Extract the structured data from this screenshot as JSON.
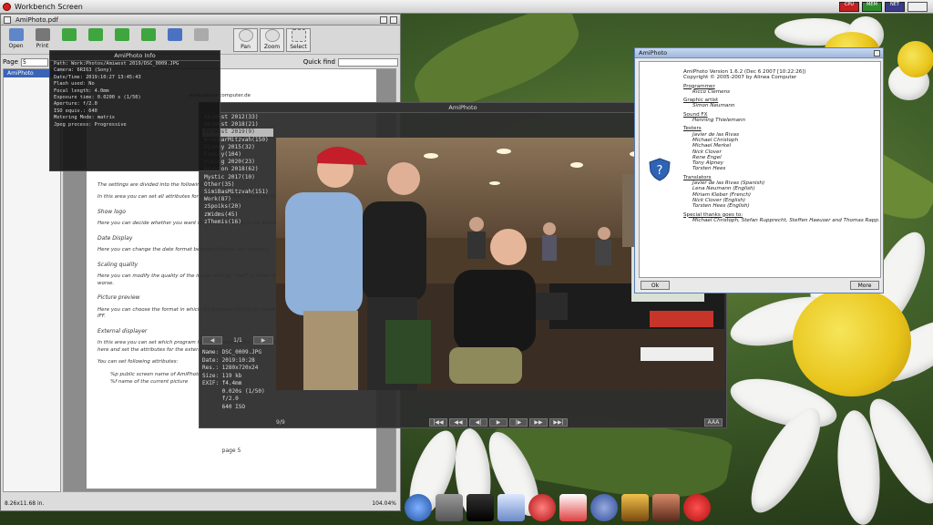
{
  "screen": {
    "title": "Workbench Screen",
    "meters": [
      "CPU",
      "MEM",
      "NET"
    ]
  },
  "pdf": {
    "window_title": "AmiPhoto.pdf",
    "toolbar": [
      "Open",
      "Print",
      "",
      "",
      "",
      "",
      "",
      "",
      "Pan",
      "Zoom",
      "Select"
    ],
    "page_label": "Page",
    "page_value": "5",
    "page_of": "of",
    "quick_find": "Quick find",
    "sidebar_selected": "AmiPhoto",
    "doc_lines": [
      "The settings are divided into the following areas:",
      "In this area you can set all attributes for the presentation. There are five types of attributes you can edit:",
      "Show logo",
      "Here you can decide whether you want the AmiPhoto-Logo to be displayed in the display area or not.",
      "Date Display",
      "Here you can change the date format between Europe and America.",
      "Scaling quality",
      "Here you can modify the quality of the image scaling. \"bad\" is faster than \"good\", but the quality is much worse.",
      "Picture preview",
      "Here you can choose the format in which the preview should be saved in. Possible formats are PNG and IFF.",
      "External displayer",
      "In this area you can set which program is used to display the images. Select the executable of the viewer here and set the attributes for the external viewer.",
      "You can set following attributes:",
      "%p  public screen name of AmiPhoto",
      "%f  name of the current picture"
    ],
    "url_fragment": "www.alinea-computer.de",
    "page_footer": "page 5",
    "status_left": "8.26x11.68 in.",
    "status_right": "104.04%"
  },
  "info": {
    "title": "AmiPhoto Info",
    "rows": [
      "Path: Work:Photos/Amiwest 2019/DSC_0009.JPG",
      "Camera: 6RI63 (Sony)",
      "Date/Time: 2019:10:27 13:45:43",
      "Flash used: No",
      "Focal length: 4.0mm",
      "Exposure time: 0.0200 s (1/50)",
      "Aperture: f/2.0",
      "ISO equiv.: 640",
      "Metering Mode: matrix",
      "Jpeg process: Progressive"
    ]
  },
  "photo": {
    "title": "AmiPhoto",
    "albums": [
      "AmiWest 2012(33)",
      "AmiWest 2018(21)",
      "AmiWest 2019(9)",
      "AronBarMitzvah(150)",
      "Disney 2015(32)",
      "Family(104)",
      "Hiking 2020(23)",
      "Houston 2018(62)",
      "Mystic 2017(10)",
      "Other(35)",
      "SimiBasMitzvah(151)",
      "Work(87)",
      "zSpoiks(20)",
      "zWidms(45)",
      "zThemis(16)"
    ],
    "selected_album_index": 2,
    "pager": "1/1",
    "meta": [
      "Name: DSC_0009.JPG",
      "Date: 2019:10:28",
      "Res.: 1280x720x24",
      "Size: 119 kb",
      "EXIF: f4.4mm",
      "      0.020s (1/50)",
      "      f/2.0",
      "      640 ISO"
    ],
    "counter": "9/9",
    "controls": [
      "|◀◀",
      "◀◀",
      "◀|",
      "▶",
      "|▶",
      "▶▶",
      "▶▶|"
    ],
    "zoom_label": "AAA"
  },
  "about": {
    "window_title": "AmiPhoto",
    "lines": [
      {
        "t": "AmiPhoto Version 1.6.2 (Dec 6 2007 [10:22:26])",
        "k": "l"
      },
      {
        "t": "Copyright © 2005-2007 by Alinea Computer",
        "k": "l"
      },
      {
        "t": "Programmer",
        "k": "hd"
      },
      {
        "t": "Ricco Clemens",
        "k": "it"
      },
      {
        "t": "Graphic artist",
        "k": "hd"
      },
      {
        "t": "Simon Neumann",
        "k": "it"
      },
      {
        "t": "Sound FX",
        "k": "hd"
      },
      {
        "t": "Henning Thielemann",
        "k": "it"
      },
      {
        "t": "Testers",
        "k": "hd"
      },
      {
        "t": "Javier de las Rivas",
        "k": "it"
      },
      {
        "t": "Michael Christoph",
        "k": "it"
      },
      {
        "t": "Michael Merkel",
        "k": "it"
      },
      {
        "t": "Nick Clover",
        "k": "it"
      },
      {
        "t": "Rene Engel",
        "k": "it"
      },
      {
        "t": "Tony Alpney",
        "k": "it"
      },
      {
        "t": "Torsten Hees",
        "k": "it"
      },
      {
        "t": "Translators",
        "k": "hd"
      },
      {
        "t": "Javier de las Rivas (Spanish)",
        "k": "it"
      },
      {
        "t": "Lena Neumann (English)",
        "k": "it"
      },
      {
        "t": "Miriam Kleber (French)",
        "k": "it"
      },
      {
        "t": "Nick Clover (English)",
        "k": "it"
      },
      {
        "t": "Torsten Hees (English)",
        "k": "it"
      },
      {
        "t": "Special thanks goes to:",
        "k": "hd"
      },
      {
        "t": "Michael Christoph, Stefan Rupprecht, Steffen Haeuser and Thomas Rapp.",
        "k": "it"
      }
    ],
    "ok_label": "Ok",
    "more_label": "More"
  },
  "dock": [
    "disk-icon",
    "shell-icon",
    "dvd-player-icon",
    "mp-icon",
    "media-play-icon",
    "gift-icon",
    "globe-icon",
    "game-icon",
    "photo-icon",
    "power-icon"
  ],
  "colors": {
    "accent": "#3b63b6",
    "power": "#d11a1a"
  }
}
